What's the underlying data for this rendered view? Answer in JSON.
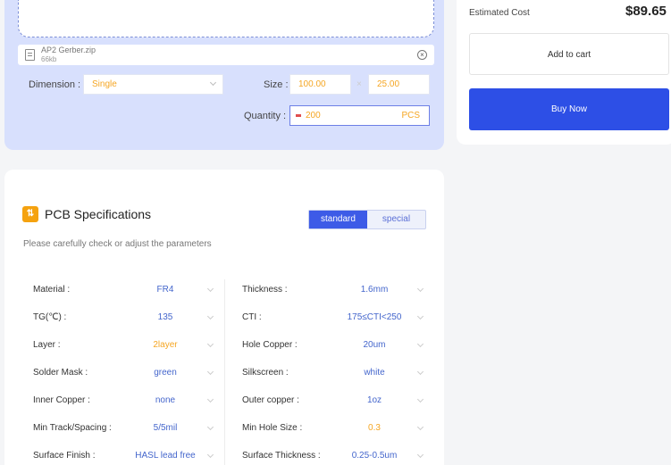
{
  "upload": {
    "file_name": "AP2 Gerber.zip",
    "file_size": "66kb"
  },
  "options": {
    "dimension_label": "Dimension :",
    "dimension_value": "Single",
    "size_label": "Size :",
    "size_x": "100.00",
    "size_sep": "×",
    "size_y": "25.00",
    "quantity_label": "Quantity :",
    "quantity_value": "200",
    "quantity_unit": "PCS"
  },
  "cost": {
    "label": "Estimated Cost",
    "value": "$89.65",
    "add_to_cart": "Add to cart",
    "buy_now": "Buy Now"
  },
  "specs": {
    "icon": "sliders-icon",
    "title": "PCB Specifications",
    "subtitle": "Please carefully check or adjust the parameters",
    "toggle_standard": "standard",
    "toggle_special": "special",
    "left": [
      {
        "label": "Material :",
        "value": "FR4",
        "highlight": false
      },
      {
        "label": "TG(℃) :",
        "value": "135",
        "highlight": false
      },
      {
        "label": "Layer :",
        "value": "2layer",
        "highlight": true
      },
      {
        "label": "Solder Mask :",
        "value": "green",
        "highlight": false
      },
      {
        "label": "Inner Copper :",
        "value": "none",
        "highlight": false
      },
      {
        "label": "Min Track/Spacing :",
        "value": "5/5mil",
        "highlight": false
      },
      {
        "label": "Surface Finish :",
        "value": "HASL lead free",
        "highlight": false
      }
    ],
    "right": [
      {
        "label": "Thickness :",
        "value": "1.6mm",
        "highlight": false
      },
      {
        "label": "CTI :",
        "value": "175≤CTI<250",
        "highlight": false
      },
      {
        "label": "Hole Copper :",
        "value": "20um",
        "highlight": false
      },
      {
        "label": "Silkscreen :",
        "value": "white",
        "highlight": false
      },
      {
        "label": "Outer copper :",
        "value": "1oz",
        "highlight": false
      },
      {
        "label": "Min Hole Size :",
        "value": "0.3",
        "highlight": true
      },
      {
        "label": "Surface Thickness :",
        "value": "0.25-0.5um",
        "highlight": false
      }
    ]
  },
  "colors": {
    "accent": "#2d4fe6",
    "highlight": "#f5a623",
    "panel": "#d8e0fd"
  }
}
